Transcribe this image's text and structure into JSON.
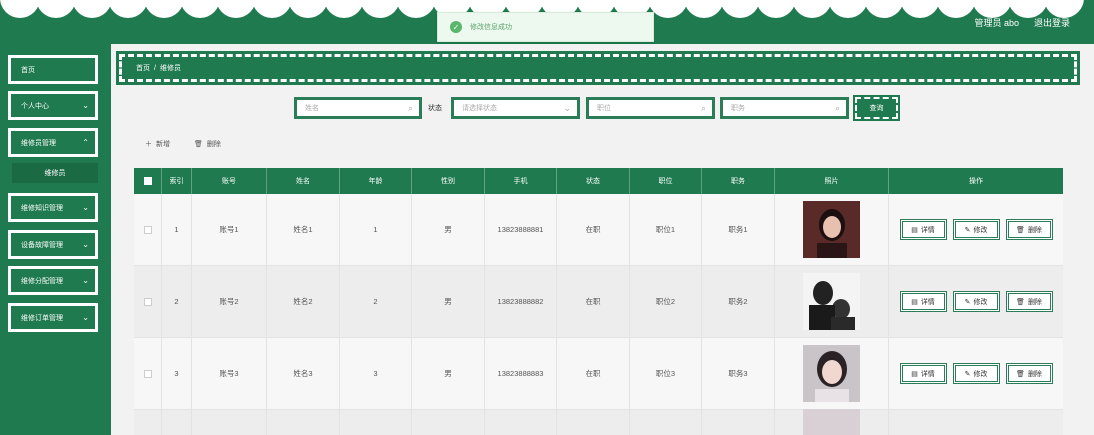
{
  "header": {
    "admin": "管理员 abo",
    "logout": "退出登录"
  },
  "toast": {
    "message": "修改信息成功"
  },
  "sidebar": {
    "items": [
      {
        "label": "首页"
      },
      {
        "label": "个人中心"
      },
      {
        "label": "维修员管理"
      },
      {
        "label": "维修知识管理"
      },
      {
        "label": "设备故障管理"
      },
      {
        "label": "维修分配管理"
      },
      {
        "label": "维修订单管理"
      }
    ],
    "submenu": "维修员"
  },
  "breadcrumb": {
    "home": "首页",
    "sep": "/",
    "current": "维修员"
  },
  "search": {
    "name_placeholder": "姓名",
    "status_label": "状态",
    "status_placeholder": "请选择状态",
    "position_placeholder": "职位",
    "duty_placeholder": "职务",
    "query_label": "查询"
  },
  "toolbar": {
    "add_label": "新增",
    "delete_label": "删除"
  },
  "table": {
    "headers": [
      "索引",
      "账号",
      "姓名",
      "年龄",
      "性别",
      "手机",
      "状态",
      "职位",
      "职务",
      "照片",
      "操作"
    ],
    "rows": [
      {
        "index": "1",
        "account": "账号1",
        "name": "姓名1",
        "age": "1",
        "gender": "男",
        "phone": "13823888881",
        "status": "在职",
        "position": "职位1",
        "duty": "职务1"
      },
      {
        "index": "2",
        "account": "账号2",
        "name": "姓名2",
        "age": "2",
        "gender": "男",
        "phone": "13823888882",
        "status": "在职",
        "position": "职位2",
        "duty": "职务2"
      },
      {
        "index": "3",
        "account": "账号3",
        "name": "姓名3",
        "age": "3",
        "gender": "男",
        "phone": "13823888883",
        "status": "在职",
        "position": "职位3",
        "duty": "职务3"
      }
    ],
    "actions": {
      "detail": "详情",
      "edit": "修改",
      "delete": "删除"
    }
  }
}
